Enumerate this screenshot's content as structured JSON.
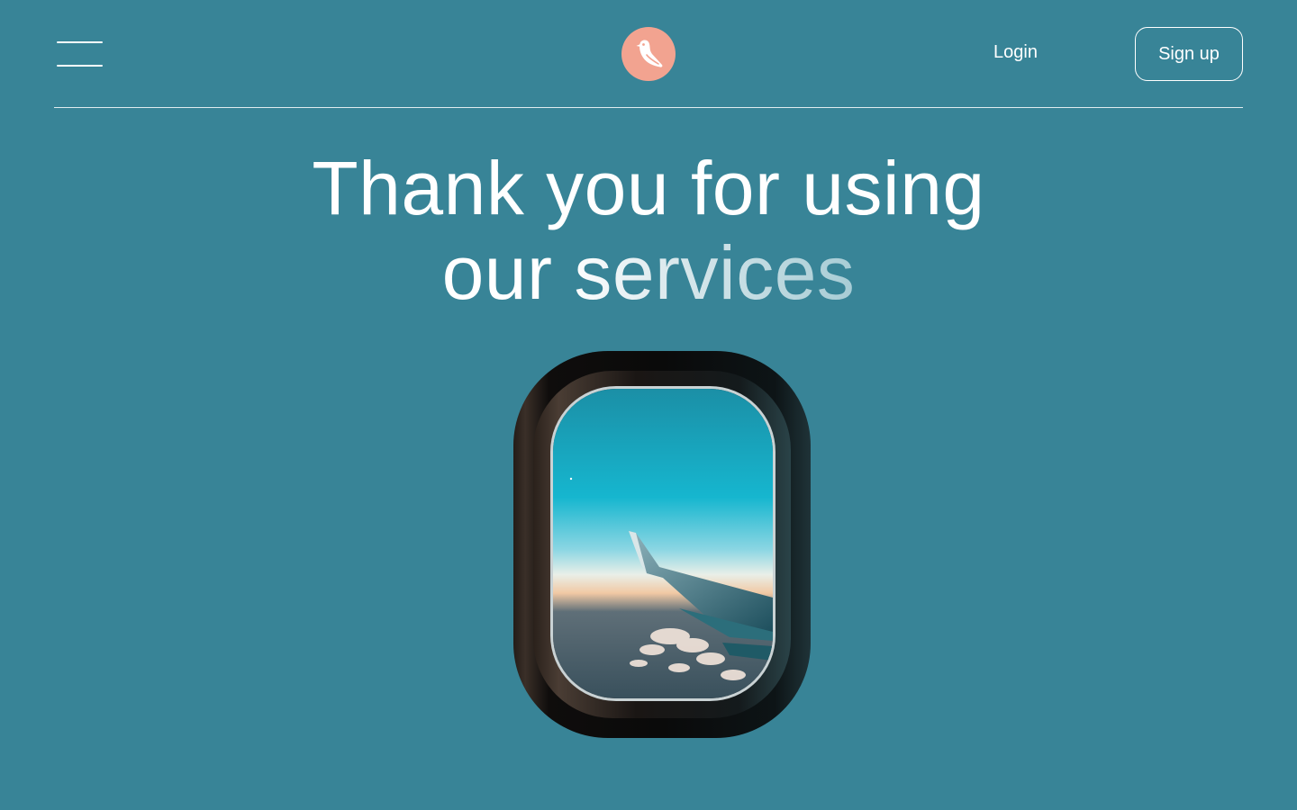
{
  "header": {
    "menu_icon": "hamburger-menu-icon",
    "logo_icon": "bird-logo-icon",
    "login_label": "Login",
    "signup_label": "Sign up"
  },
  "hero": {
    "title_line1": "Thank you for using",
    "title_line2": "our services"
  },
  "illustration": {
    "name": "airplane-window-image"
  },
  "colors": {
    "background": "#388497",
    "logo_bg": "#f2a390",
    "text": "#ffffff"
  }
}
